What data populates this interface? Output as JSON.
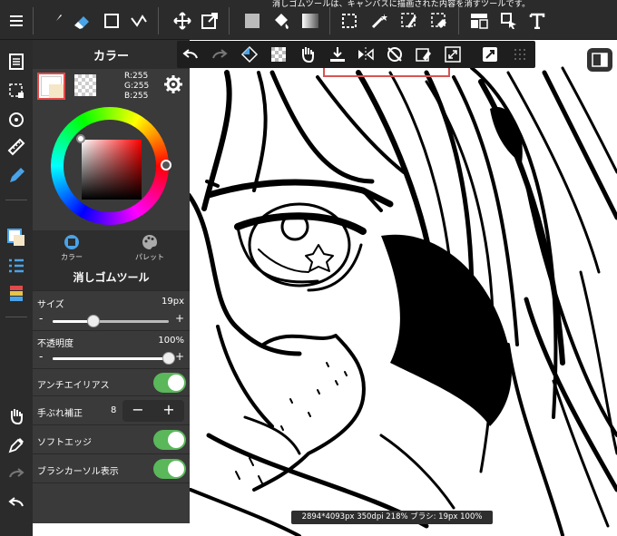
{
  "topbar": {
    "notice": "消しゴムツールは、キャンバスに描画された内容を消すツールです。",
    "tools": [
      "menu-icon",
      "brush-icon",
      "eraser-icon",
      "rectangle-icon",
      "vector-icon",
      "move-icon",
      "transform-icon",
      "fill-color-icon",
      "bucket-icon",
      "gradient-icon",
      "selection-icon",
      "magic-wand-icon",
      "select-pen-icon",
      "select-eraser-icon",
      "panel-icon",
      "pointer-select-icon",
      "text-icon"
    ]
  },
  "color_panel": {
    "header": "カラー",
    "rgb": {
      "r": "R:255",
      "g": "G:255",
      "b": "B:255"
    },
    "tabs": [
      {
        "label": "カラー",
        "icon": "color-tab-icon"
      },
      {
        "label": "パレット",
        "icon": "palette-tab-icon"
      }
    ],
    "main_color": "#ffffff",
    "sub_color": "#f5e6c8"
  },
  "eraser_panel": {
    "header": "消しゴムツール",
    "size": {
      "label": "サイズ",
      "value": "19px",
      "minus": "-",
      "plus": "+",
      "level": 0.35
    },
    "opacity": {
      "label": "不透明度",
      "value": "100%",
      "minus": "-",
      "plus": "+",
      "level": 1.0
    },
    "antialias": {
      "label": "アンチエイリアス",
      "on": true
    },
    "stabilizer": {
      "label": "手ぶれ補正",
      "value": "8",
      "minus": "−",
      "plus": "+"
    },
    "soft_edge": {
      "label": "ソフトエッジ",
      "on": true
    },
    "brush_cursor": {
      "label": "ブラシカーソル表示",
      "on": true
    }
  },
  "floatbar": {
    "tools": [
      "undo-icon",
      "redo-icon",
      "flip-icon",
      "transparent-icon",
      "hand-icon",
      "download-icon",
      "mirror-icon",
      "rotate-lock-icon",
      "clear-icon",
      "fullscreen-icon",
      "snap-icon",
      "grid-icon"
    ]
  },
  "status": {
    "text": "2894*4093px 350dpi 218% ブラシ: 19px 100%"
  }
}
